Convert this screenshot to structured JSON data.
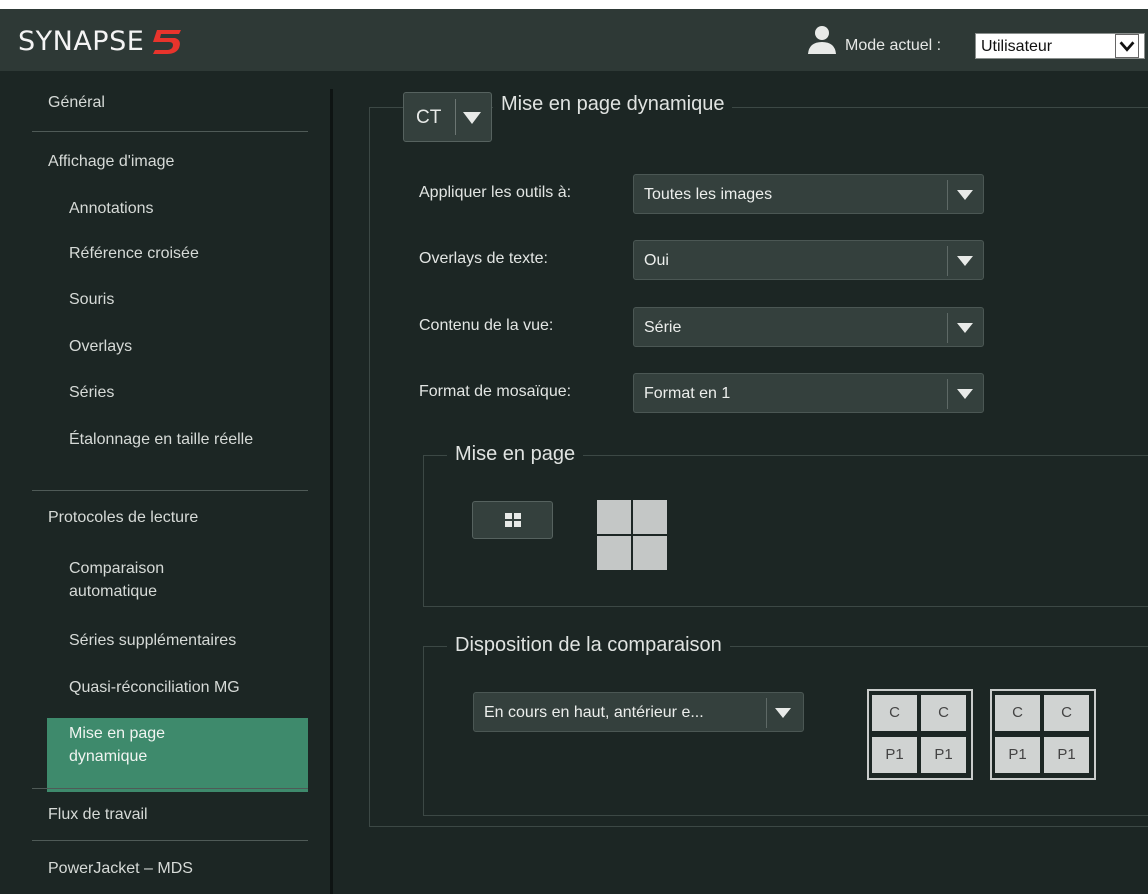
{
  "header": {
    "logo_text": "SYNAPSE",
    "logo_mark": "5",
    "user_icon": "user-icon",
    "mode_label": "Mode actuel :",
    "mode_value": "Utilisateur"
  },
  "sidebar": {
    "items": [
      {
        "label": "Général",
        "level": "top"
      },
      {
        "label": "Affichage d'image",
        "level": "top"
      },
      {
        "label": "Annotations",
        "level": "sub"
      },
      {
        "label": "Référence croisée",
        "level": "sub"
      },
      {
        "label": "Souris",
        "level": "sub"
      },
      {
        "label": "Overlays",
        "level": "sub"
      },
      {
        "label": "Séries",
        "level": "sub"
      },
      {
        "label": "Étalonnage en taille réelle",
        "level": "sub"
      },
      {
        "label": "Protocoles de lecture",
        "level": "top"
      },
      {
        "label": "Comparaison automatique",
        "level": "sub"
      },
      {
        "label": "Séries supplémentaires",
        "level": "sub"
      },
      {
        "label": "Quasi-réconciliation MG",
        "level": "sub"
      },
      {
        "label": "Mise en page dynamique",
        "level": "sub",
        "active": true
      },
      {
        "label": "Flux de travail",
        "level": "top"
      },
      {
        "label": "PowerJacket – MDS",
        "level": "top"
      }
    ]
  },
  "main": {
    "modality": "CT",
    "section_title": "Mise en page dynamique",
    "fields": [
      {
        "label": "Appliquer les outils à:",
        "value": "Toutes les images"
      },
      {
        "label": "Overlays de texte:",
        "value": "Oui"
      },
      {
        "label": "Contenu de la vue:",
        "value": "Série"
      },
      {
        "label": "Format de mosaïque:",
        "value": "Format en 1"
      }
    ],
    "layout_section": {
      "title": "Mise en page"
    },
    "comparison_section": {
      "title": "Disposition de la comparaison",
      "dropdown_value": "En cours en haut, antérieur e...",
      "grids": [
        [
          "C",
          "C",
          "P1",
          "P1"
        ],
        [
          "C",
          "C",
          "P1",
          "P1"
        ]
      ]
    }
  },
  "colors": {
    "background": "#1c2624",
    "header": "#2e3936",
    "active_item": "#3e8a6c",
    "logo_accent": "#e8342c"
  }
}
